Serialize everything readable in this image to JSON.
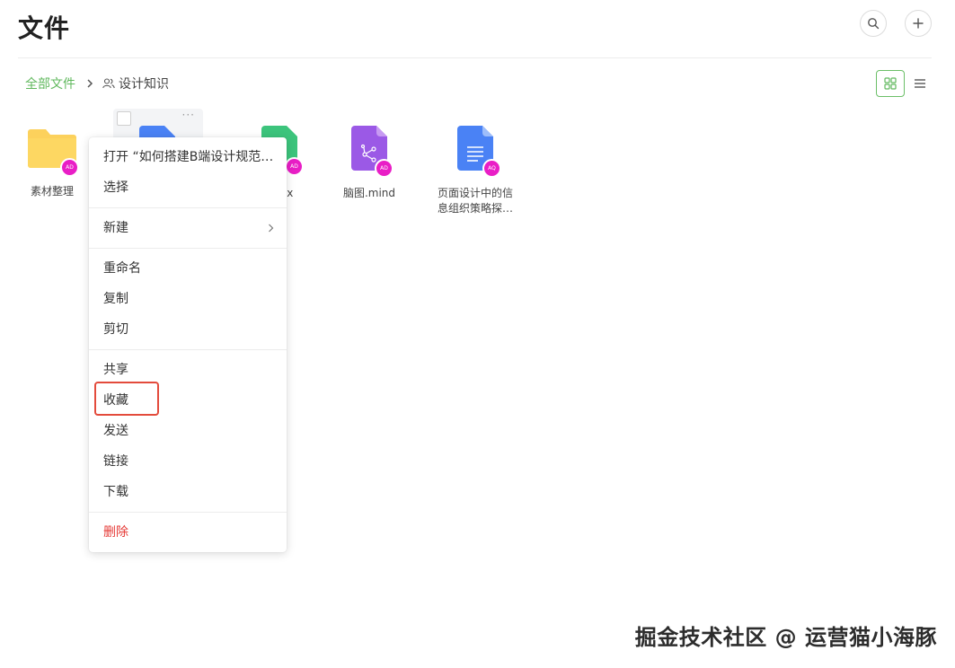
{
  "header": {
    "title": "文件",
    "search_icon": "search-icon",
    "add_icon": "plus-icon"
  },
  "breadcrumb": {
    "root": "全部文件",
    "current": "设计知识",
    "current_icon": "team-icon"
  },
  "view": {
    "grid_icon": "grid-view-icon",
    "list_icon": "list-view-icon"
  },
  "files": [
    {
      "name": "素材整理",
      "type": "folder",
      "badge": "AD"
    },
    {
      "name": "",
      "type": "doc",
      "badge": ""
    },
    {
      "name": "sx",
      "type": "sheet",
      "badge": "AD"
    },
    {
      "name": "脑图.mind",
      "type": "mind",
      "badge": "AD"
    },
    {
      "name": "页面设计中的信息组织策略探…",
      "type": "doc",
      "badge": "AQ"
    }
  ],
  "hover_card": {
    "more": "···"
  },
  "context_menu": {
    "open": "打开 “如何搭建B端设计规范…",
    "select": "选择",
    "new": "新建",
    "rename": "重命名",
    "copy": "复制",
    "cut": "剪切",
    "share": "共享",
    "favorite": "收藏",
    "send": "发送",
    "link": "链接",
    "download": "下载",
    "delete": "删除"
  },
  "colors": {
    "accent_green": "#5fb85c",
    "danger_red": "#e53935",
    "highlight_red": "#e34b3c",
    "badge_magenta": "#e91ec6",
    "folder_yellow": "#fcd15c",
    "doc_blue": "#4a82f5",
    "sheet_green": "#3cc47c",
    "mind_purple": "#9b59e6"
  },
  "watermark": "掘金技术社区 @ 运营猫小海豚"
}
